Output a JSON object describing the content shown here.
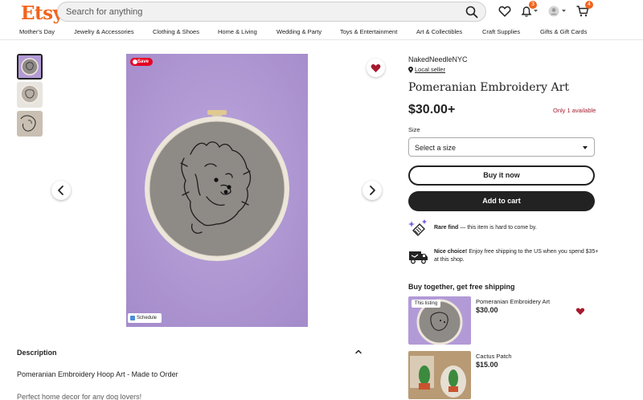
{
  "header": {
    "logo": "Etsy",
    "search_placeholder": "Search for anything",
    "notifications_badge": "3",
    "cart_badge": "4"
  },
  "nav": [
    "Mother's Day",
    "Jewelry & Accessories",
    "Clothing & Shoes",
    "Home & Living",
    "Wedding & Party",
    "Toys & Entertainment",
    "Art & Collectibles",
    "Craft Supplies",
    "Gifts & Gift Cards"
  ],
  "gallery": {
    "save_label": "Save",
    "schedule_label": "Schedule"
  },
  "description": {
    "title": "Description",
    "line1": "Pomeranian Embroidery Hoop Art - Made to Order",
    "line2": "Perfect home decor for any dog lovers!"
  },
  "listing": {
    "shop_name": "NakedNeedleNYC",
    "local_seller": "Local seller",
    "title": "Pomeranian Embroidery Art",
    "price": "$30.00+",
    "availability": "Only 1 available",
    "size_label": "Size",
    "size_value": "Select a size",
    "buy_now": "Buy it now",
    "add_to_cart": "Add to cart",
    "perk1_bold": "Rare find",
    "perk1_text": " — this item is hard to come by.",
    "perk2_bold": "Nice choice!",
    "perk2_text": " Enjoy free shipping to the US when you spend $35+ at this shop."
  },
  "buy_together": {
    "title": "Buy together, get free shipping",
    "this_listing": "This listing",
    "items": [
      {
        "name": "Pomeranian Embroidery Art",
        "price": "$30.00"
      },
      {
        "name": "Cactus Patch",
        "price": "$15.00"
      }
    ]
  },
  "colors": {
    "brand": "#f1641e",
    "favorite": "#a61a2e",
    "image_bg": "#b29ad6"
  }
}
